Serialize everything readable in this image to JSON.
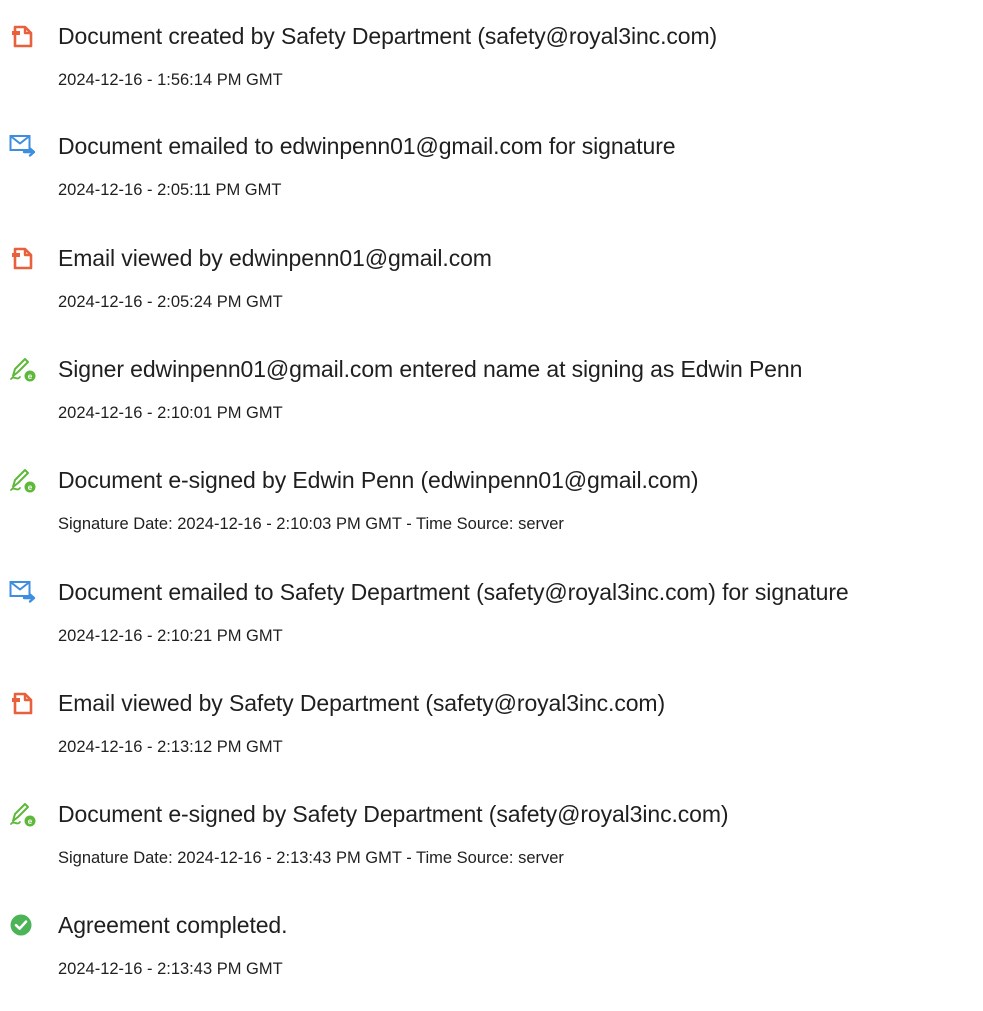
{
  "events": [
    {
      "icon": "document-icon",
      "title": "Document created by Safety Department (safety@royal3inc.com)",
      "subtitle": "2024-12-16 - 1:56:14 PM GMT"
    },
    {
      "icon": "email-icon",
      "title": "Document emailed to edwinpenn01@gmail.com for signature",
      "subtitle": "2024-12-16 - 2:05:11 PM GMT"
    },
    {
      "icon": "document-icon",
      "title": "Email viewed by edwinpenn01@gmail.com",
      "subtitle": "2024-12-16 - 2:05:24 PM GMT"
    },
    {
      "icon": "pen-sign-icon",
      "title": "Signer edwinpenn01@gmail.com entered name at signing as Edwin Penn",
      "subtitle": "2024-12-16 - 2:10:01 PM GMT"
    },
    {
      "icon": "pen-sign-icon",
      "title": "Document e-signed by Edwin Penn (edwinpenn01@gmail.com)",
      "subtitle": "Signature Date: 2024-12-16 - 2:10:03 PM GMT - Time Source: server"
    },
    {
      "icon": "email-icon",
      "title": "Document emailed to Safety Department (safety@royal3inc.com) for signature",
      "subtitle": "2024-12-16 - 2:10:21 PM GMT"
    },
    {
      "icon": "document-icon",
      "title": "Email viewed by Safety Department (safety@royal3inc.com)",
      "subtitle": "2024-12-16 - 2:13:12 PM GMT"
    },
    {
      "icon": "pen-sign-icon",
      "title": "Document e-signed by Safety Department (safety@royal3inc.com)",
      "subtitle": "Signature Date: 2024-12-16 - 2:13:43 PM GMT - Time Source: server"
    },
    {
      "icon": "check-circle-icon",
      "title": "Agreement completed.",
      "subtitle": "2024-12-16 - 2:13:43 PM GMT"
    }
  ],
  "colors": {
    "document_icon": "#e8603c",
    "email_icon": "#3d8ee0",
    "pen_icon": "#5eb83a",
    "check_icon": "#4cb356",
    "text": "#1f1f1f"
  }
}
